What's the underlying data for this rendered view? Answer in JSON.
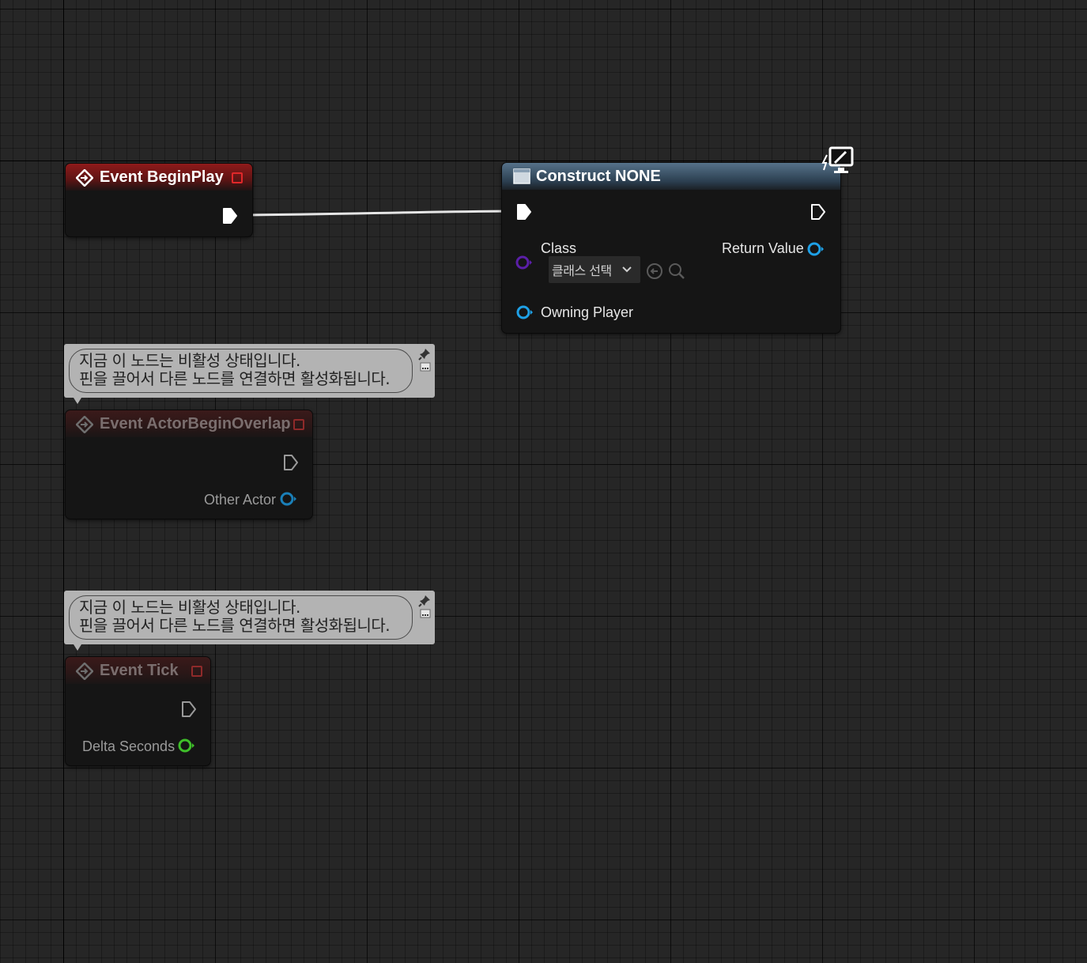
{
  "nodes": {
    "begin_play": {
      "title": "Event BeginPlay"
    },
    "construct": {
      "title": "Construct NONE",
      "class_label": "Class",
      "class_value": "클래스 선택",
      "return_label": "Return Value",
      "owning_label": "Owning Player"
    },
    "overlap": {
      "title": "Event ActorBeginOverlap",
      "output_label": "Other Actor"
    },
    "tick": {
      "title": "Event Tick",
      "output_label": "Delta Seconds"
    }
  },
  "comments": {
    "disabled_line1": "지금 이 노드는 비활성 상태입니다.",
    "disabled_line2": "핀을 끌어서 다른 노드를 연결하면 활성화됩니다."
  },
  "colors": {
    "exec": "#ffffff",
    "object_pin": "#1ea0e6",
    "class_pin": "#5b1fa8",
    "float_pin": "#3fbf2a",
    "delegate": "#e0282a"
  }
}
